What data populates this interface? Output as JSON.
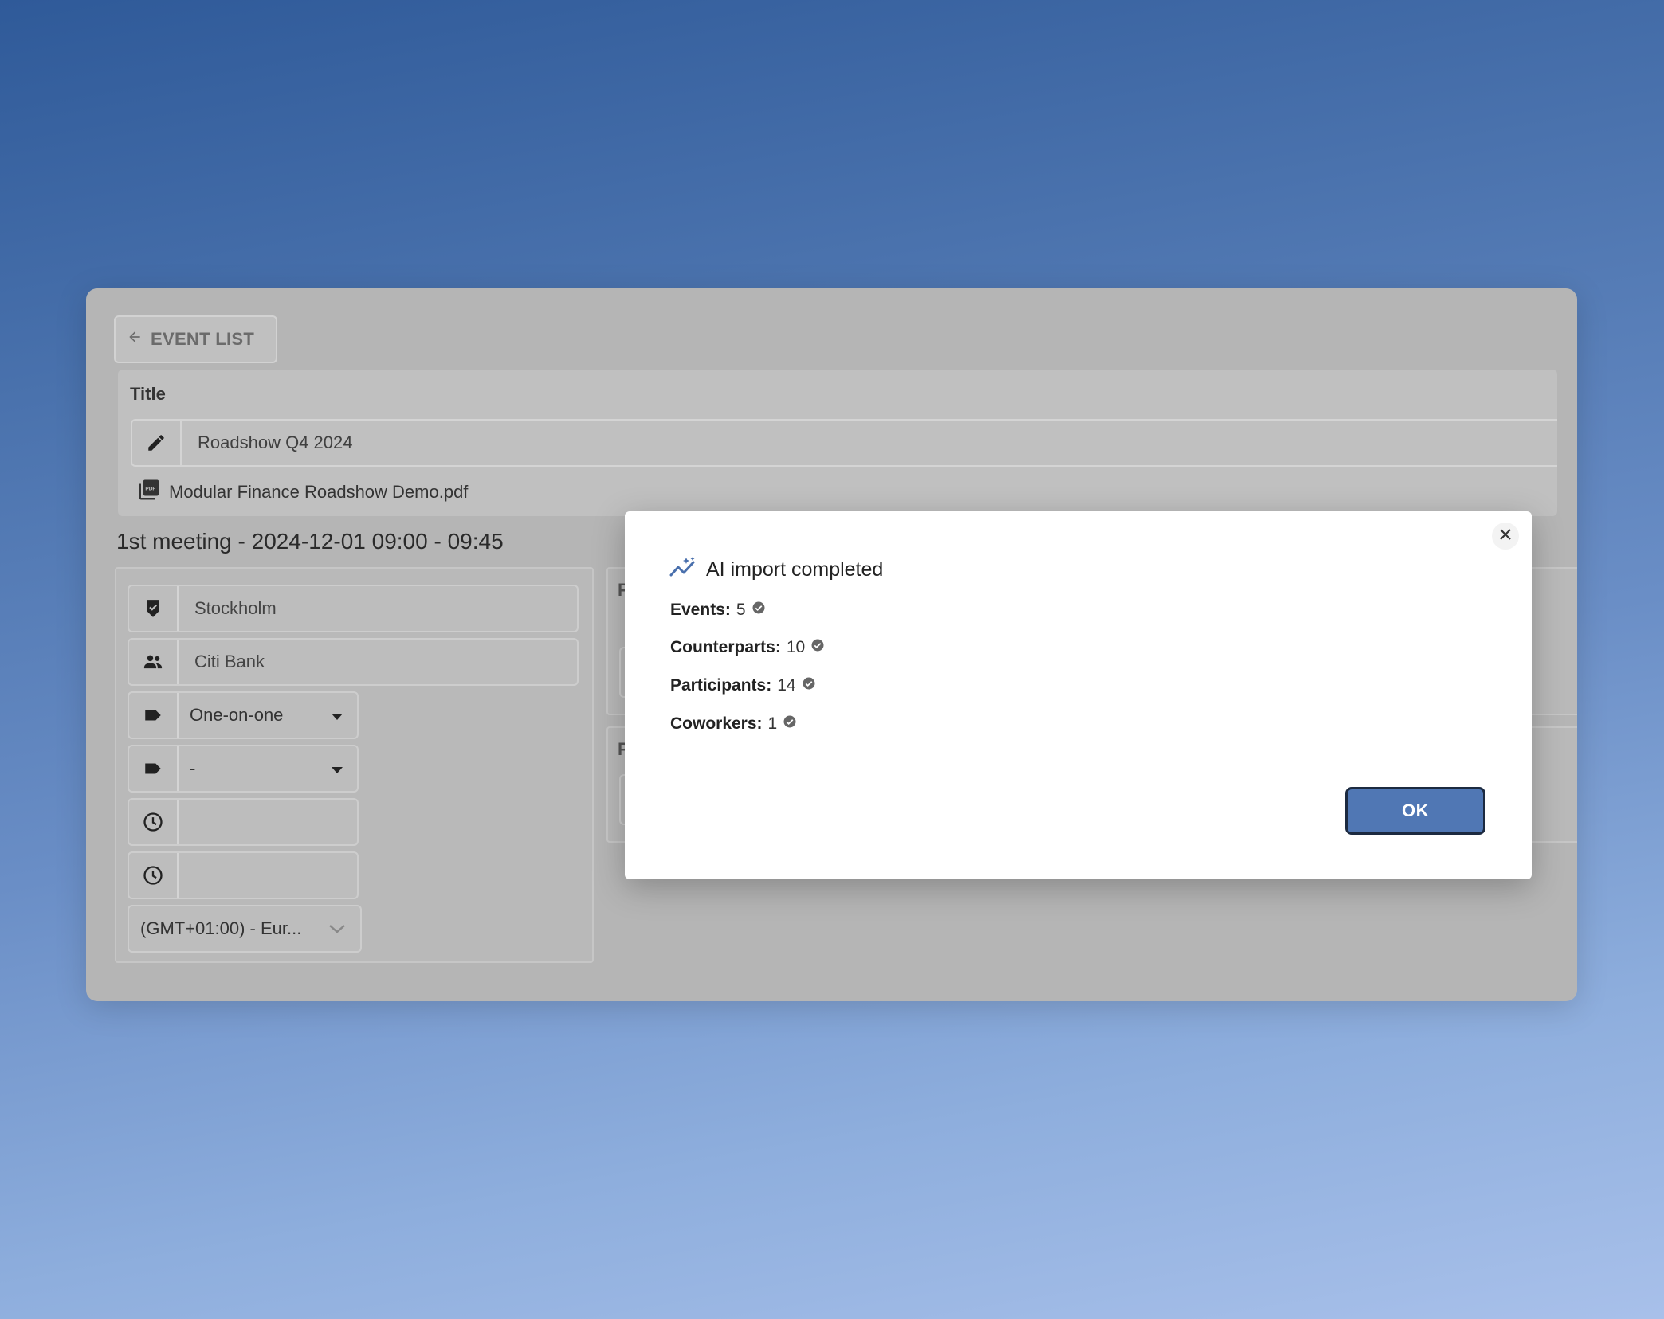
{
  "back": {
    "label": "EVENT LIST"
  },
  "event": {
    "title_label": "Title",
    "title_value": "Roadshow Q4 2024",
    "attachment": "Modular Finance Roadshow Demo.pdf"
  },
  "meeting": {
    "heading": "1st meeting - 2024-12-01 09:00 - 09:45",
    "location": "Stockholm",
    "counterpart": "Citi Bank",
    "type_selected": "One-on-one",
    "tag_selected": "-",
    "start_time": "",
    "end_time": "",
    "timezone": "(GMT+01:00) - Eur..."
  },
  "right_cards": {
    "card1_label": "P",
    "card2_label": "P"
  },
  "modal": {
    "title": "AI import completed",
    "stats": [
      {
        "label": "Events:",
        "value": "5"
      },
      {
        "label": "Counterparts:",
        "value": "10"
      },
      {
        "label": "Participants:",
        "value": "14"
      },
      {
        "label": "Coworkers:",
        "value": "1"
      }
    ],
    "ok_label": "OK"
  },
  "colors": {
    "accent": "#5077b4",
    "ok_border": "#1c2a40",
    "overlay": "#b5b5b5"
  }
}
